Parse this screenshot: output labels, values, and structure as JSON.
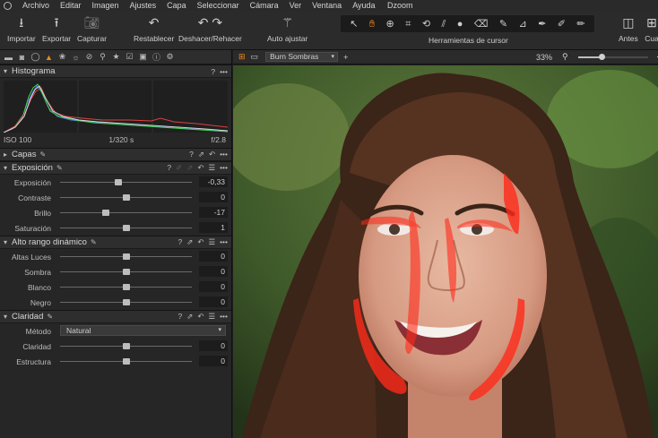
{
  "menubar": {
    "items": [
      "Archivo",
      "Editar",
      "Imagen",
      "Ajustes",
      "Capa",
      "Seleccionar",
      "Cámara",
      "Ver",
      "Ventana",
      "Ayuda"
    ],
    "window_title": "Dzoom"
  },
  "toolbar": {
    "import_label": "Importar",
    "export_label": "Exportar",
    "capture_label": "Capturar",
    "reset_label": "Restablecer",
    "undo_redo_label": "Deshacer/Rehacer",
    "auto_adjust_label": "Auto ajustar",
    "cursor_tools_label": "Herramientas de cursor",
    "before_label": "Antes",
    "quad_label": "Cua"
  },
  "histogram": {
    "title": "Histograma",
    "iso": "ISO 100",
    "shutter": "1/320 s",
    "aperture": "f/2.8",
    "colors": {
      "red": "#e04040",
      "green": "#3fd24a",
      "blue": "#4a6cf0",
      "luma": "#d8d8d8"
    }
  },
  "layers": {
    "title": "Capas"
  },
  "exposure": {
    "title": "Exposición",
    "rows": [
      {
        "label": "Exposición",
        "value": "-0,33",
        "level": -0.11
      },
      {
        "label": "Contraste",
        "value": "0",
        "level": 0
      },
      {
        "label": "Brillo",
        "value": "-17",
        "level": -0.3
      },
      {
        "label": "Saturación",
        "value": "1",
        "level": 0.01
      }
    ]
  },
  "hdr": {
    "title": "Alto rango dinámico",
    "rows": [
      {
        "label": "Altas Luces",
        "value": "0",
        "level": 0
      },
      {
        "label": "Sombra",
        "value": "0",
        "level": 0
      },
      {
        "label": "Blanco",
        "value": "0",
        "level": 0
      },
      {
        "label": "Negro",
        "value": "0",
        "level": 0
      }
    ]
  },
  "clarity": {
    "title": "Claridad",
    "method_label": "Método",
    "method_value": "Natural",
    "rows": [
      {
        "label": "Claridad",
        "value": "0",
        "level": 0
      },
      {
        "label": "Estructura",
        "value": "0",
        "level": 0
      }
    ]
  },
  "viewer": {
    "layer_select": "Burn Sombras",
    "zoom": "33%",
    "zoom_level": 0.33,
    "mask_color": "#ff2a1a",
    "accent": "#f08a1a"
  }
}
